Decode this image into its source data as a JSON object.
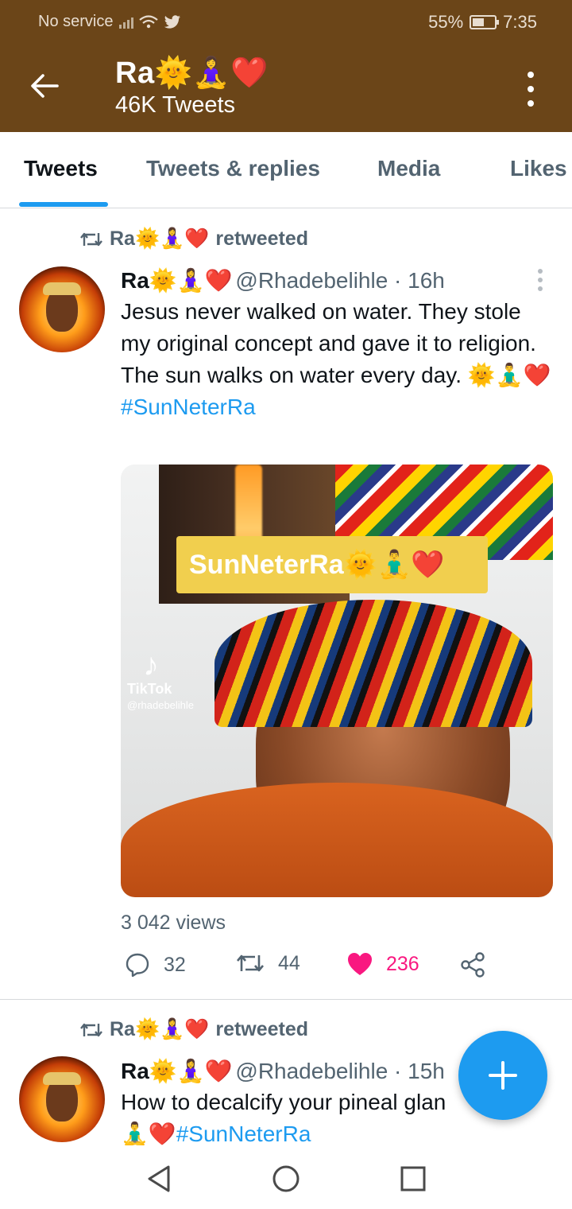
{
  "status_bar": {
    "carrier": "No service",
    "battery": "55%",
    "battery_level": 0.55,
    "time": "7:35"
  },
  "profile": {
    "name": "Ra🌞🧘‍♀️❤️",
    "tweet_count": "46K Tweets"
  },
  "tabs": [
    {
      "label": "Tweets",
      "active": true
    },
    {
      "label": "Tweets & replies",
      "active": false
    },
    {
      "label": "Media",
      "active": false
    },
    {
      "label": "Likes",
      "active": false
    }
  ],
  "tweets": [
    {
      "retweeted_by": "Ra🌞🧘‍♀️❤️",
      "retweeted_label": "retweeted",
      "author_name": "Ra🌞🧘‍♀️❤️",
      "handle_time": "@Rhadebelihle · 16h",
      "text": "Jesus never walked on water. They stole my original concept and gave it to religion. The sun walks on water every day. 🌞🧘‍♂️❤️",
      "hashtag": "#SunNeterRa",
      "media": {
        "banner_text": "SunNeterRa🌞🧘‍♂️❤️",
        "watermark_brand": "TikTok",
        "watermark_handle": "@rhadebelihle"
      },
      "views": "3 042 views",
      "replies": "32",
      "retweets": "44",
      "likes": "236"
    },
    {
      "retweeted_by": "Ra🌞🧘‍♀️❤️",
      "retweeted_label": "retweeted",
      "author_name": "Ra🌞🧘‍♀️❤️",
      "handle_time": "@Rhadebelihle · 15h",
      "text": "How to decalcify your pineal glan",
      "emoji_prefix": "🧘‍♂️❤️",
      "hashtag": "#SunNeterRa"
    }
  ],
  "colors": {
    "header_bg": "#6b4518",
    "accent": "#1d9bf0",
    "like": "#f91880",
    "muted": "#536471"
  },
  "icons": {
    "back": "arrow-left-icon",
    "more": "more-vertical-icon",
    "reply": "speech-bubble-icon",
    "retweet": "retweet-icon",
    "like": "heart-icon",
    "share": "share-icon",
    "compose": "plus-icon"
  }
}
